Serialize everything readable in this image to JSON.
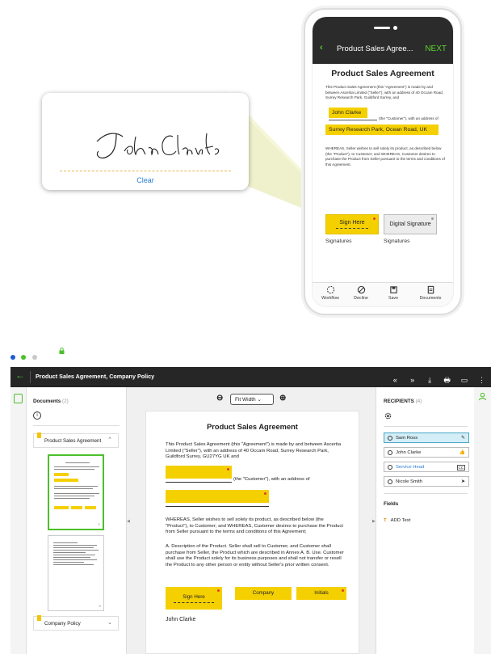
{
  "signature_card": {
    "signature_text": "John Clarke",
    "clear_label": "Clear"
  },
  "phone": {
    "back_icon": "chevron-left-icon",
    "title": "Product Sales Agree...",
    "next_label": "NEXT",
    "doc_title": "Product Sales Agreement",
    "para1": "This Product Sales Agreement (this \"Agreement\") is made by and between Ascertia Limited (\"Seller\"), with an address of 40 Occam Road, Surrey Research Park, Guildford Surrey, and",
    "name_field": "John Clarke",
    "customer_text": "(the \"Customer\"), with an address of",
    "address_field": "Surrey Research Park, Ocean Road, UK",
    "para2": "WHEREAS, Seller wishes to sell solely its product, as described below (the \"Product\"), to Customer; and WHEREAS, Customer desires to purchase the Product from Seller pursuant to the terms and conditions of this Agreement.",
    "sign_here": "Sign Here",
    "digital_signature": "Digital Signature",
    "signatures_label_1": "Signatures",
    "signatures_label_2": "Signatures",
    "bottom_nav": [
      {
        "label": "Workflow",
        "icon": "workflow-icon"
      },
      {
        "label": "Decline",
        "icon": "decline-icon"
      },
      {
        "label": "Save",
        "icon": "save-icon"
      },
      {
        "label": "Documents",
        "icon": "documents-icon"
      }
    ]
  },
  "app": {
    "title": "Product Sales Agreement, Company Policy",
    "tools": [
      "«",
      "»",
      "⤓",
      "🖶",
      "▭",
      "⋮"
    ],
    "documents_label": "Documents",
    "documents_count": "(2)",
    "doc_groups": [
      "Product Sales Agreement",
      "Company Policy"
    ],
    "thumb_pages": [
      "1",
      "2"
    ],
    "zoom_value": "Fit Width",
    "zoom_out_icon": "zoom-out-icon",
    "zoom_in_icon": "zoom-in-icon",
    "page": {
      "title": "Product Sales Agreement",
      "para1": "This Product Sales Agreement (this \"Agreement\") is made by and between Ascertia Limited (\"Seller\"), with an address of 40 Occam Road, Surrey Research Park, Guildford Surrey, GU27YG UK and",
      "customer_text": "(the \"Customer\"), with an address of",
      "para2": "WHEREAS, Seller wishes to sell solely its product, as described below (the \"Product\"), to Customer; and WHEREAS, Customer desires to purchase the Product from Seller pursuant to the terms and conditions of this Agreement;",
      "para3": "A. Description of the Product. Seller shall sell to Customer, and Customer shall purchase from Seller, the Product which are described in Annex A. B. Use. Customer shall use the Product solely for its business purposes and shall not transfer or resell the Product to any other person or entity without Seller's prior written consent.",
      "sign_here": "Sign Here",
      "company": "Company",
      "initials": "Initials",
      "signer_name": "John Clarke"
    },
    "recipients_label": "RECIPIENTS",
    "recipients_count": "(4)",
    "recipients": [
      {
        "name": "Sam Ross",
        "icon": "pen-icon",
        "active": true
      },
      {
        "name": "John Clarke",
        "icon": "thumbs-up-icon",
        "active": false
      },
      {
        "name": "Service Head",
        "icon": "cc-icon",
        "active": false
      },
      {
        "name": "Nicole Smith",
        "icon": "cursor-icon",
        "active": false
      }
    ],
    "fields_label": "Fields",
    "field_items": [
      {
        "label": "ADD Text",
        "icon": "text-icon"
      }
    ]
  },
  "colors": {
    "accent_green": "#4cc02a",
    "field_yellow": "#f5d000",
    "topbar_dark": "#262626",
    "link_blue": "#2a7fd4"
  }
}
